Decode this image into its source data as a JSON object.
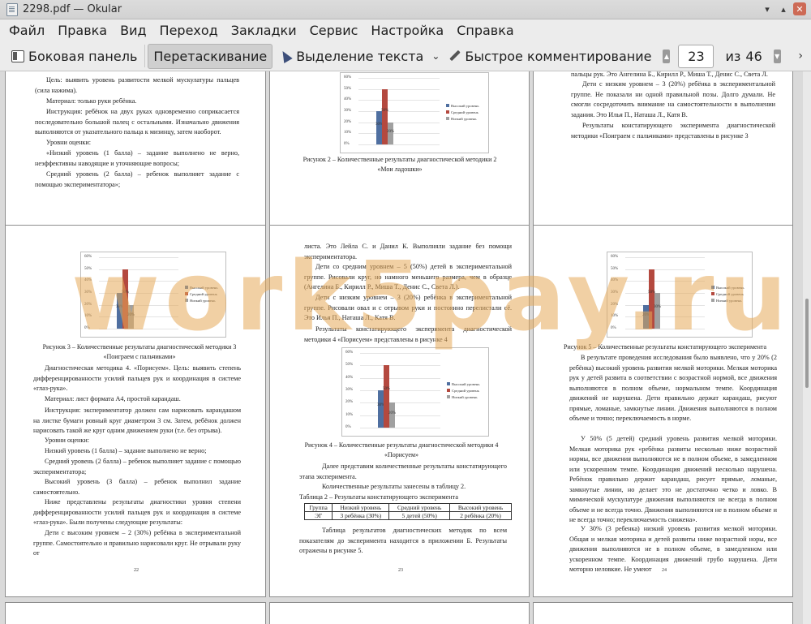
{
  "window": {
    "title": "2298.pdf  — Okular"
  },
  "menu": [
    "Файл",
    "Правка",
    "Вид",
    "Переход",
    "Закладки",
    "Сервис",
    "Настройка",
    "Справка"
  ],
  "toolbar": {
    "sidebar_label": "Боковая панель",
    "drag_label": "Перетаскивание",
    "text_select_label": "Выделение текста",
    "quick_comment_label": "Быстрое комментирование",
    "current_page": "23",
    "of_label": "из",
    "total_pages": "46"
  },
  "watermark": "work5pay.ru",
  "legend": [
    "Высокий уровень",
    "Средний уровень",
    "Низкий уровень"
  ],
  "yticks": [
    "60%",
    "50%",
    "40%",
    "30%",
    "20%",
    "10%",
    "0%"
  ],
  "colors": {
    "high": "#4f6fa0",
    "mid": "#b4493f",
    "low": "#a0a0a0"
  },
  "chart_data": [
    {
      "type": "bar",
      "page": "20",
      "categories": [
        "Высокий уровень",
        "Средний уровень",
        "Низкий уровень"
      ],
      "values": [
        30,
        50,
        20
      ],
      "labels": [
        "30%",
        "50%",
        "20%"
      ],
      "ylim": [
        0,
        60
      ]
    },
    {
      "type": "bar",
      "page": "22",
      "categories": [
        "Высокий уровень",
        "Средний уровень",
        "Низкий уровень"
      ],
      "values": [
        30,
        50,
        20
      ],
      "labels": [
        "30%",
        "50%",
        "20%"
      ],
      "ylim": [
        0,
        60
      ]
    },
    {
      "type": "bar",
      "page": "23",
      "categories": [
        "Высокий уровень",
        "Средний уровень",
        "Низкий уровень"
      ],
      "values": [
        30,
        50,
        20
      ],
      "labels": [
        "30%",
        "50%",
        "20%"
      ],
      "ylim": [
        0,
        60
      ]
    },
    {
      "type": "bar",
      "page": "24",
      "categories": [
        "Высокий уровень",
        "Средний уровень",
        "Низкий уровень"
      ],
      "values": [
        20,
        50,
        30
      ],
      "labels": [
        "20%",
        "50%",
        "30%"
      ],
      "ylim": [
        0,
        60
      ]
    }
  ],
  "p19": {
    "text": [
      "Цель: выявить уровень развитости мелкой мускулатуры пальцев (сила нажима).",
      "Материал: только руки ребёнка.",
      "Инструкция: ребёнок на двух руках одновременно соприкасается последовательно большой палец с остальными. Изначально движения выполняются от указательного пальца к мизинцу, затем наоборот.",
      "Уровни оценки:",
      "«Низкий уровень (1 балла) – задание выполнено не верно, неэффективны наводящие и уточняющие вопросы;",
      "Средний уровень (2 балла) – ребенок выполняет задание с помощью экспериментатора»;"
    ],
    "num": "19"
  },
  "p20": {
    "caption": "Рисунок 2 – Количественные результаты диагностической методики 2 «Мои ладошки»",
    "num": "20"
  },
  "p21": {
    "text": [
      "пальцы рук. Это Ангелина Б., Кирилл Р., Миша Т., Денис С., Света Л.",
      "Дети с низким уровнем – 3 (20%) ребёнка в экспериментальной группе. Не показали ни одной правильной позы. Долго думали. Не смогли сосредоточить внимание на самостоятельности в выполнении задания. Это Илья П., Наташа Л., Катя В.",
      "Результаты констатирующего эксперимента диагностической методики «Поиграем с пальчиками» представлены в рисунке 3"
    ],
    "num": "21"
  },
  "p22": {
    "caption": "Рисунок 3 – Количественные результаты диагностической методики 3 «Поиграем с пальчиками»",
    "text": [
      "Диагностическая методика 4. «Порисуем». Цель: выявить степень дифференцированности усилий пальцев рук и координация в системе «глаз-рука».",
      "Материал: лист формата А4, простой карандаш.",
      "Инструкция: экспериментатор должен сам нарисовать карандашом на листке бумаги ровный круг диаметром 3 см. Затем, ребёнок должен нарисовать такой же круг одним движением руки (т.е. без отрыва).",
      "Уровни оценки:",
      "Низкий уровень (1 балла) – задание выполнено не верно;",
      "Средний уровень (2 балла) – ребенок выполняет задание с помощью экспериментатора;",
      "Высокий уровень (3 балла) – ребенок выполнил задание самостоятельно.",
      "Ниже представлены результаты диагностики уровня степени дифференцированности усилий пальцев рук и координация в системе «глаз-рука». Были получены следующие результаты:",
      "Дети с высоким уровнем – 2 (30%) ребёнка в экспериментальной группе. Самостоятельно и правильно нарисовали круг. Не отрывали руку от"
    ],
    "num": "22"
  },
  "p23": {
    "text_top": [
      "листа. Это Лейла С. и Данил К. Выполняли задание без помощи экспериментатора.",
      "Дети со средним уровнем – 5 (50%) детей в экспериментальной группе. Рисовали круг, но намного меньшего размера, чем в образце (Ангелина Б., Кирилл Р., Миша Т., Денис С., Света Л.).",
      "Дети с низким уровнем – 3 (20%) ребёнка в экспериментальной группе. Рисовали овал и с отрывом руки и постоянно перелистали сё. Это Илья П., Наташа Л., Катя В.",
      "Результаты констатирующего эксперимента диагностической методики 4 «Порисуем» представлены в рисунке 4"
    ],
    "caption": "Рисунок 4 – Количественные результаты диагностической методики 4 «Порисуем»",
    "text_mid": [
      "Далее представим количественные результаты констатирующего этапа эксперимента.",
      "Количественные результаты занесены в таблицу 2."
    ],
    "table_title": "Таблица 2 – Результаты констатирующего эксперимента",
    "table_head": [
      "Группа",
      "Низкий уровень",
      "Средний уровень",
      "Высокий уровень"
    ],
    "table_row": [
      "ЭГ",
      "3 ребёнка (30%)",
      "5 детей (50%)",
      "2 ребёнка (20%)"
    ],
    "text_bottom": [
      "Таблица результатов диагностических методик по всем показателям до эксперимента находится в приложении Б. Результаты отражены в рисунке 5."
    ],
    "num": "23"
  },
  "p24": {
    "caption": "Рисунок 5 – Количественные результаты констатирующего эксперимента",
    "text": [
      "В результате проведения исследования было выявлено, что у 20% (2 ребёнка) высокий уровень развития мелкой моторики. Мелкая моторика рук у детей развита в соответствии с возрастной нормой, все движения выполняются в полном объеме, нормальном темпе. Координация движений не нарушена. Дети правильно держат карандаш, рисуют прямые, ломаные, замкнутые линии. Движения выполняются в полном объеме и точно; переключаемость в норме.",
      "У 50% (5 детей) средний уровень развития мелкой моторики. Мелкая моторика рук «ребёнка развиты несколько ниже возрастной нормы, все движения выполняются не в полном объеме, в замедленном или ускоренном темпе. Координация движений несколько нарушена. Ребёнок правильно держит карандаш, рисует прямые, ломаные, замкнутые линии, но делает это не достаточно четко и ловко. В мимической мускулатуре движения выполняются не всегда в полном объеме и не всегда точно. Движения выполняются не в полном объеме и не всегда точно; переключаемость снижена».",
      "У 30% (3 ребенка) низкий уровень развития мелкой моторики. Общая и мелкая моторика и детей развиты ниже возрастной норы, все движения выполняются не в полном объеме, в замедленном или ускоренном темпе. Координация движений грубо нарушена. Дети моторно неловкие. Не умеют"
    ],
    "num": "24"
  }
}
